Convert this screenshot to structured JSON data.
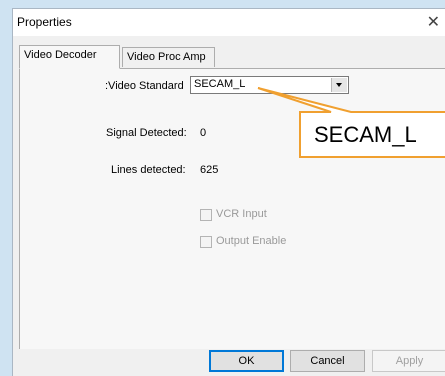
{
  "window": {
    "title": "Properties",
    "close_glyph": "✕"
  },
  "tabs": [
    {
      "label": "Video Decoder",
      "active": true
    },
    {
      "label": "Video Proc Amp",
      "active": false
    }
  ],
  "video_standard": {
    "label": ":Video Standard",
    "value": "SECAM_L"
  },
  "signal_detected": {
    "label": "Signal Detected:",
    "value": "0"
  },
  "lines_detected": {
    "label": "Lines detected:",
    "value": "625"
  },
  "checkboxes": {
    "vcr_input": {
      "label": "VCR Input",
      "checked": false,
      "enabled": false
    },
    "output_enable": {
      "label": "Output Enable",
      "checked": false,
      "enabled": false
    }
  },
  "buttons": {
    "ok": "OK",
    "cancel": "Cancel",
    "apply": "Apply"
  },
  "callout": {
    "text": "SECAM_L",
    "border_color": "#f0a030"
  }
}
